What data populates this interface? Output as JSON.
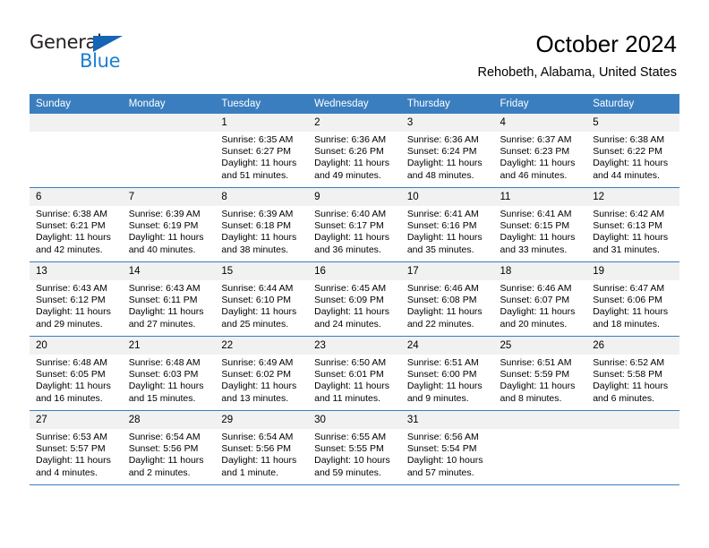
{
  "brand": {
    "name_part1": "General",
    "name_part2": "Blue",
    "triangle_icon": "triangle-icon",
    "color_dark": "#231f20",
    "color_blue": "#1b7fd4"
  },
  "header": {
    "title": "October 2024",
    "subtitle": "Rehobeth, Alabama, United States"
  },
  "theme": {
    "header_bg": "#3a7ebf",
    "daynum_bg": "#f1f1f1",
    "cell_bg": "#ffffff",
    "grid_line": "#3a7ebf"
  },
  "calendar": {
    "weekdays": [
      "Sunday",
      "Monday",
      "Tuesday",
      "Wednesday",
      "Thursday",
      "Friday",
      "Saturday"
    ],
    "weeks": [
      [
        {
          "day": "",
          "blank": true
        },
        {
          "day": "",
          "blank": true
        },
        {
          "day": "1",
          "sunrise": "Sunrise: 6:35 AM",
          "sunset": "Sunset: 6:27 PM",
          "daylight1": "Daylight: 11 hours",
          "daylight2": "and 51 minutes."
        },
        {
          "day": "2",
          "sunrise": "Sunrise: 6:36 AM",
          "sunset": "Sunset: 6:26 PM",
          "daylight1": "Daylight: 11 hours",
          "daylight2": "and 49 minutes."
        },
        {
          "day": "3",
          "sunrise": "Sunrise: 6:36 AM",
          "sunset": "Sunset: 6:24 PM",
          "daylight1": "Daylight: 11 hours",
          "daylight2": "and 48 minutes."
        },
        {
          "day": "4",
          "sunrise": "Sunrise: 6:37 AM",
          "sunset": "Sunset: 6:23 PM",
          "daylight1": "Daylight: 11 hours",
          "daylight2": "and 46 minutes."
        },
        {
          "day": "5",
          "sunrise": "Sunrise: 6:38 AM",
          "sunset": "Sunset: 6:22 PM",
          "daylight1": "Daylight: 11 hours",
          "daylight2": "and 44 minutes."
        }
      ],
      [
        {
          "day": "6",
          "sunrise": "Sunrise: 6:38 AM",
          "sunset": "Sunset: 6:21 PM",
          "daylight1": "Daylight: 11 hours",
          "daylight2": "and 42 minutes."
        },
        {
          "day": "7",
          "sunrise": "Sunrise: 6:39 AM",
          "sunset": "Sunset: 6:19 PM",
          "daylight1": "Daylight: 11 hours",
          "daylight2": "and 40 minutes."
        },
        {
          "day": "8",
          "sunrise": "Sunrise: 6:39 AM",
          "sunset": "Sunset: 6:18 PM",
          "daylight1": "Daylight: 11 hours",
          "daylight2": "and 38 minutes."
        },
        {
          "day": "9",
          "sunrise": "Sunrise: 6:40 AM",
          "sunset": "Sunset: 6:17 PM",
          "daylight1": "Daylight: 11 hours",
          "daylight2": "and 36 minutes."
        },
        {
          "day": "10",
          "sunrise": "Sunrise: 6:41 AM",
          "sunset": "Sunset: 6:16 PM",
          "daylight1": "Daylight: 11 hours",
          "daylight2": "and 35 minutes."
        },
        {
          "day": "11",
          "sunrise": "Sunrise: 6:41 AM",
          "sunset": "Sunset: 6:15 PM",
          "daylight1": "Daylight: 11 hours",
          "daylight2": "and 33 minutes."
        },
        {
          "day": "12",
          "sunrise": "Sunrise: 6:42 AM",
          "sunset": "Sunset: 6:13 PM",
          "daylight1": "Daylight: 11 hours",
          "daylight2": "and 31 minutes."
        }
      ],
      [
        {
          "day": "13",
          "sunrise": "Sunrise: 6:43 AM",
          "sunset": "Sunset: 6:12 PM",
          "daylight1": "Daylight: 11 hours",
          "daylight2": "and 29 minutes."
        },
        {
          "day": "14",
          "sunrise": "Sunrise: 6:43 AM",
          "sunset": "Sunset: 6:11 PM",
          "daylight1": "Daylight: 11 hours",
          "daylight2": "and 27 minutes."
        },
        {
          "day": "15",
          "sunrise": "Sunrise: 6:44 AM",
          "sunset": "Sunset: 6:10 PM",
          "daylight1": "Daylight: 11 hours",
          "daylight2": "and 25 minutes."
        },
        {
          "day": "16",
          "sunrise": "Sunrise: 6:45 AM",
          "sunset": "Sunset: 6:09 PM",
          "daylight1": "Daylight: 11 hours",
          "daylight2": "and 24 minutes."
        },
        {
          "day": "17",
          "sunrise": "Sunrise: 6:46 AM",
          "sunset": "Sunset: 6:08 PM",
          "daylight1": "Daylight: 11 hours",
          "daylight2": "and 22 minutes."
        },
        {
          "day": "18",
          "sunrise": "Sunrise: 6:46 AM",
          "sunset": "Sunset: 6:07 PM",
          "daylight1": "Daylight: 11 hours",
          "daylight2": "and 20 minutes."
        },
        {
          "day": "19",
          "sunrise": "Sunrise: 6:47 AM",
          "sunset": "Sunset: 6:06 PM",
          "daylight1": "Daylight: 11 hours",
          "daylight2": "and 18 minutes."
        }
      ],
      [
        {
          "day": "20",
          "sunrise": "Sunrise: 6:48 AM",
          "sunset": "Sunset: 6:05 PM",
          "daylight1": "Daylight: 11 hours",
          "daylight2": "and 16 minutes."
        },
        {
          "day": "21",
          "sunrise": "Sunrise: 6:48 AM",
          "sunset": "Sunset: 6:03 PM",
          "daylight1": "Daylight: 11 hours",
          "daylight2": "and 15 minutes."
        },
        {
          "day": "22",
          "sunrise": "Sunrise: 6:49 AM",
          "sunset": "Sunset: 6:02 PM",
          "daylight1": "Daylight: 11 hours",
          "daylight2": "and 13 minutes."
        },
        {
          "day": "23",
          "sunrise": "Sunrise: 6:50 AM",
          "sunset": "Sunset: 6:01 PM",
          "daylight1": "Daylight: 11 hours",
          "daylight2": "and 11 minutes."
        },
        {
          "day": "24",
          "sunrise": "Sunrise: 6:51 AM",
          "sunset": "Sunset: 6:00 PM",
          "daylight1": "Daylight: 11 hours",
          "daylight2": "and 9 minutes."
        },
        {
          "day": "25",
          "sunrise": "Sunrise: 6:51 AM",
          "sunset": "Sunset: 5:59 PM",
          "daylight1": "Daylight: 11 hours",
          "daylight2": "and 8 minutes."
        },
        {
          "day": "26",
          "sunrise": "Sunrise: 6:52 AM",
          "sunset": "Sunset: 5:58 PM",
          "daylight1": "Daylight: 11 hours",
          "daylight2": "and 6 minutes."
        }
      ],
      [
        {
          "day": "27",
          "sunrise": "Sunrise: 6:53 AM",
          "sunset": "Sunset: 5:57 PM",
          "daylight1": "Daylight: 11 hours",
          "daylight2": "and 4 minutes."
        },
        {
          "day": "28",
          "sunrise": "Sunrise: 6:54 AM",
          "sunset": "Sunset: 5:56 PM",
          "daylight1": "Daylight: 11 hours",
          "daylight2": "and 2 minutes."
        },
        {
          "day": "29",
          "sunrise": "Sunrise: 6:54 AM",
          "sunset": "Sunset: 5:56 PM",
          "daylight1": "Daylight: 11 hours",
          "daylight2": "and 1 minute."
        },
        {
          "day": "30",
          "sunrise": "Sunrise: 6:55 AM",
          "sunset": "Sunset: 5:55 PM",
          "daylight1": "Daylight: 10 hours",
          "daylight2": "and 59 minutes."
        },
        {
          "day": "31",
          "sunrise": "Sunrise: 6:56 AM",
          "sunset": "Sunset: 5:54 PM",
          "daylight1": "Daylight: 10 hours",
          "daylight2": "and 57 minutes."
        },
        {
          "day": "",
          "blank": true
        },
        {
          "day": "",
          "blank": true
        }
      ]
    ]
  }
}
